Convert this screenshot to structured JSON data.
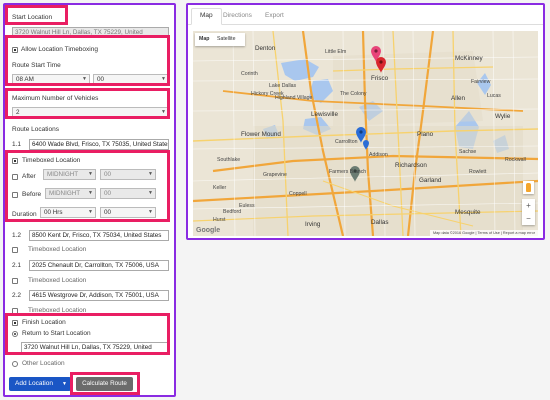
{
  "left_panel": {
    "start_location": {
      "label": "Start Location",
      "value": "3720 Walnut Hill Ln, Dallas, TX 75229, United"
    },
    "timeboxing": {
      "checkbox_label": "Allow Location Timeboxing",
      "checked": true,
      "route_start_time_label": "Route Start Time",
      "hour": "08 AM",
      "minute": "00"
    },
    "vehicles": {
      "label": "Maximum Number of Vehicles",
      "value": "2"
    },
    "route_locations_label": "Route Locations",
    "locations": [
      {
        "number": "1.1",
        "address": "6400 Wade Blvd, Frisco, TX 75035, United States"
      },
      {
        "number": "1.2",
        "address": "8500 Kent Dr, Frisco, TX 75034, United States"
      },
      {
        "number": "2.1",
        "address": "2025 Chenault Dr, Carrollton, TX 75006, USA"
      },
      {
        "number": "2.2",
        "address": "4615 Westgrove Dr, Addison, TX 75001, USA"
      }
    ],
    "timeboxed_location": {
      "checkbox_label": "Timeboxed Location",
      "after_label": "After",
      "after_hour": "MIDNIGHT",
      "after_minute": "00",
      "before_label": "Before",
      "before_hour": "MIDNIGHT",
      "before_minute": "00",
      "duration_label": "Duration",
      "duration_hours": "00 Hrs",
      "duration_minutes": "00"
    },
    "finish": {
      "finish_label": "Finish Location",
      "return_label": "Return to Start Location",
      "return_value": "3720 Walnut Hill Ln, Dallas, TX 75229, United",
      "other_label": "Other Location"
    },
    "buttons": {
      "add_location": "Add Location",
      "calculate_route": "Calculate Route"
    }
  },
  "right_panel": {
    "tabs": [
      {
        "label": "Map"
      },
      {
        "label": "Directions"
      },
      {
        "label": "Export"
      }
    ],
    "map": {
      "map_type_map": "Map",
      "map_type_satellite": "Satellite",
      "cities": [
        "Denton",
        "Little Elm",
        "Frisco",
        "McKinney",
        "Corinth",
        "Lake Dallas",
        "Hickory Creek",
        "Highland Village",
        "Lewisville",
        "Flower Mound",
        "The Colony",
        "Plano",
        "Allen",
        "Fairview",
        "Wylie",
        "Carrollton",
        "Addison",
        "Farmers Branch",
        "Richardson",
        "Garland",
        "Grapevine",
        "Coppell",
        "Irving",
        "Dallas",
        "Mesquite",
        "Rowlett",
        "Sachse",
        "Rockwall",
        "Southlake",
        "Keller",
        "Euless",
        "Bedford",
        "Hurst",
        "Lucas"
      ],
      "attribution": "Map data ©2016 Google  |  Terms of Use  |  Report a map error",
      "google_logo": "Google"
    },
    "marker_colors": {
      "pink": "#e8457a",
      "red": "#d9272e",
      "blue": "#2b6dd6",
      "gray": "#6b7c72"
    }
  }
}
